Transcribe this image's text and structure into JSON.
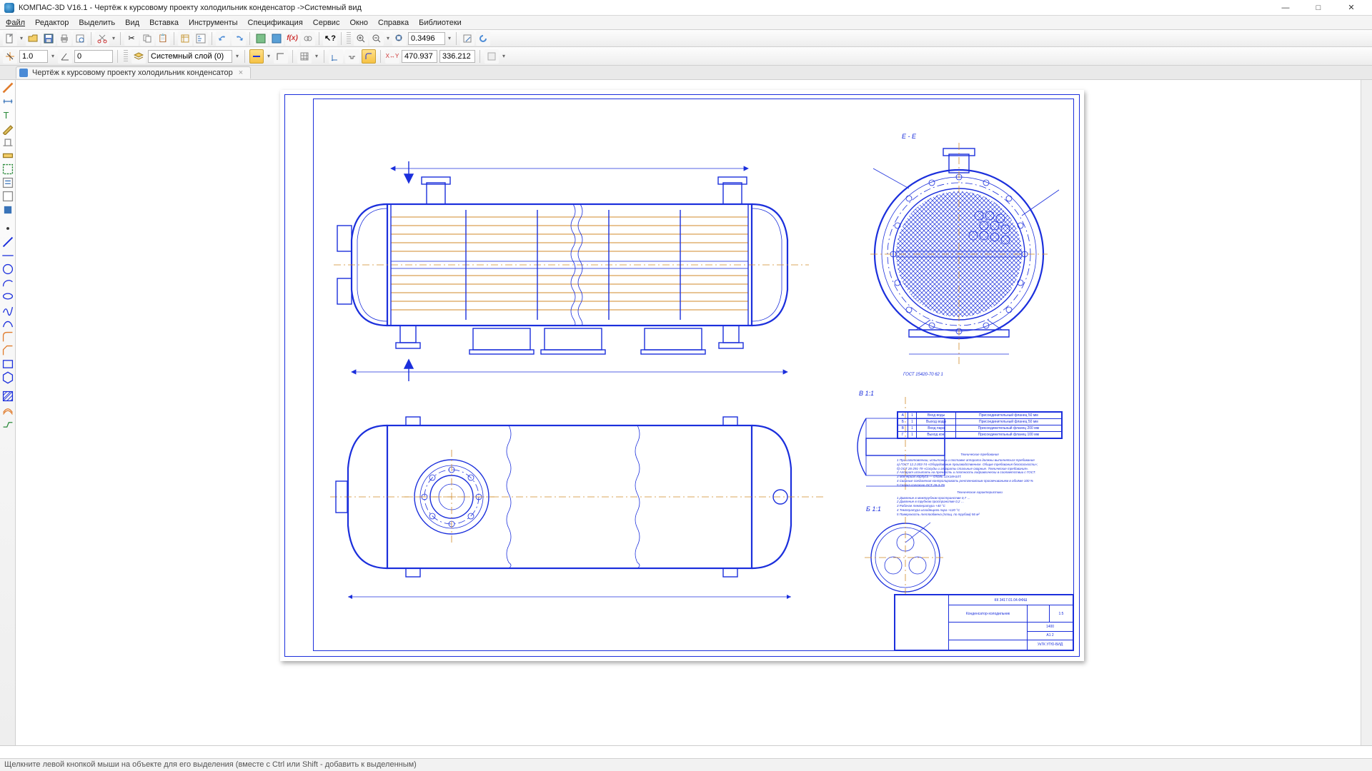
{
  "window": {
    "title": "КОМПАС-3D V16.1 - Чертёж к курсовому проекту холодильник конденсатор ->Системный вид"
  },
  "menu": {
    "file": "Файл",
    "edit": "Редактор",
    "select": "Выделить",
    "view": "Вид",
    "insert": "Вставка",
    "tools": "Инструменты",
    "spec": "Спецификация",
    "service": "Сервис",
    "window": "Окно",
    "help": "Справка",
    "libs": "Библиотеки"
  },
  "toolbar1": {
    "zoom_value": "0.3496"
  },
  "toolbar2": {
    "step": "1.0",
    "angle": "0",
    "layer": "Системный слой (0)",
    "coord_x": "470.937",
    "coord_y": "336.212"
  },
  "doctab": {
    "name": "Чертёж к курсовому проекту холодильник конденсатор"
  },
  "cmdline": {
    "value": ""
  },
  "status": {
    "hint": "Щелкните левой кнопкой мыши на объекте для его выделения (вместе с Ctrl или Shift - добавить к выделенным)"
  },
  "drawing": {
    "section_EE": "Е - Е",
    "section_B": "Б 1:1",
    "section_V": "В 1:1",
    "gost": "ГОСТ 15420-70 62 1",
    "title_block": {
      "designation": "КК 3417.01.04.ФФШ",
      "name": "Конденсатор-холодильник",
      "school": "УкТК УГЮ-БИД",
      "sheet_fmt": "A1 2",
      "scale": "1:5",
      "mass": "1400"
    },
    "nozzle_table": [
      [
        "А",
        "1",
        "Вход воды",
        "Присоединительный фланец 50 мм"
      ],
      [
        "Б",
        "1",
        "Выход воды",
        "Присоединительный фланец 50 мм"
      ],
      [
        "В",
        "1",
        "Вход пара",
        "Присоединительный фланец 200 мм"
      ],
      [
        "Г",
        "1",
        "Выход кон.",
        "Присоединительный фланец 100 мм"
      ]
    ],
    "tech_title1": "Технические требования",
    "tech_title2": "Технические характеристики",
    "tech_lines": [
      "1 При изготовлении, испытании и поставке аппарата должны выполняться требования",
      "а) ГОСТ 12.2.003-74 «Оборудование производственное. Общие требования безопасности»;",
      "б) ОСТ 26-291-79 «Сосуды и аппараты стальные сварные. Технические требования».",
      "2 Аппарат испытать на прочность и плотность гидравлически в соответствии с ГОСТ.",
      "3 Материал корпуса — сталь 12Х18Н10Т.",
      "4 Сварные соединения контролировать рентгеновским просвечиванием в объёме 100 %",
      "5 Сварка согласно ОСТ 26-3-79."
    ],
    "char_lines": [
      "1 Давление в межтрубном пространстве 0,7 …",
      "2 Давление в трубном пространстве 0,2 …",
      "3 Рабочая температура +40 °C",
      "4 Температура исходящего пара +120 °C",
      "5 Поверхность теплообмена (площ. по трубам) 56 м²"
    ]
  }
}
